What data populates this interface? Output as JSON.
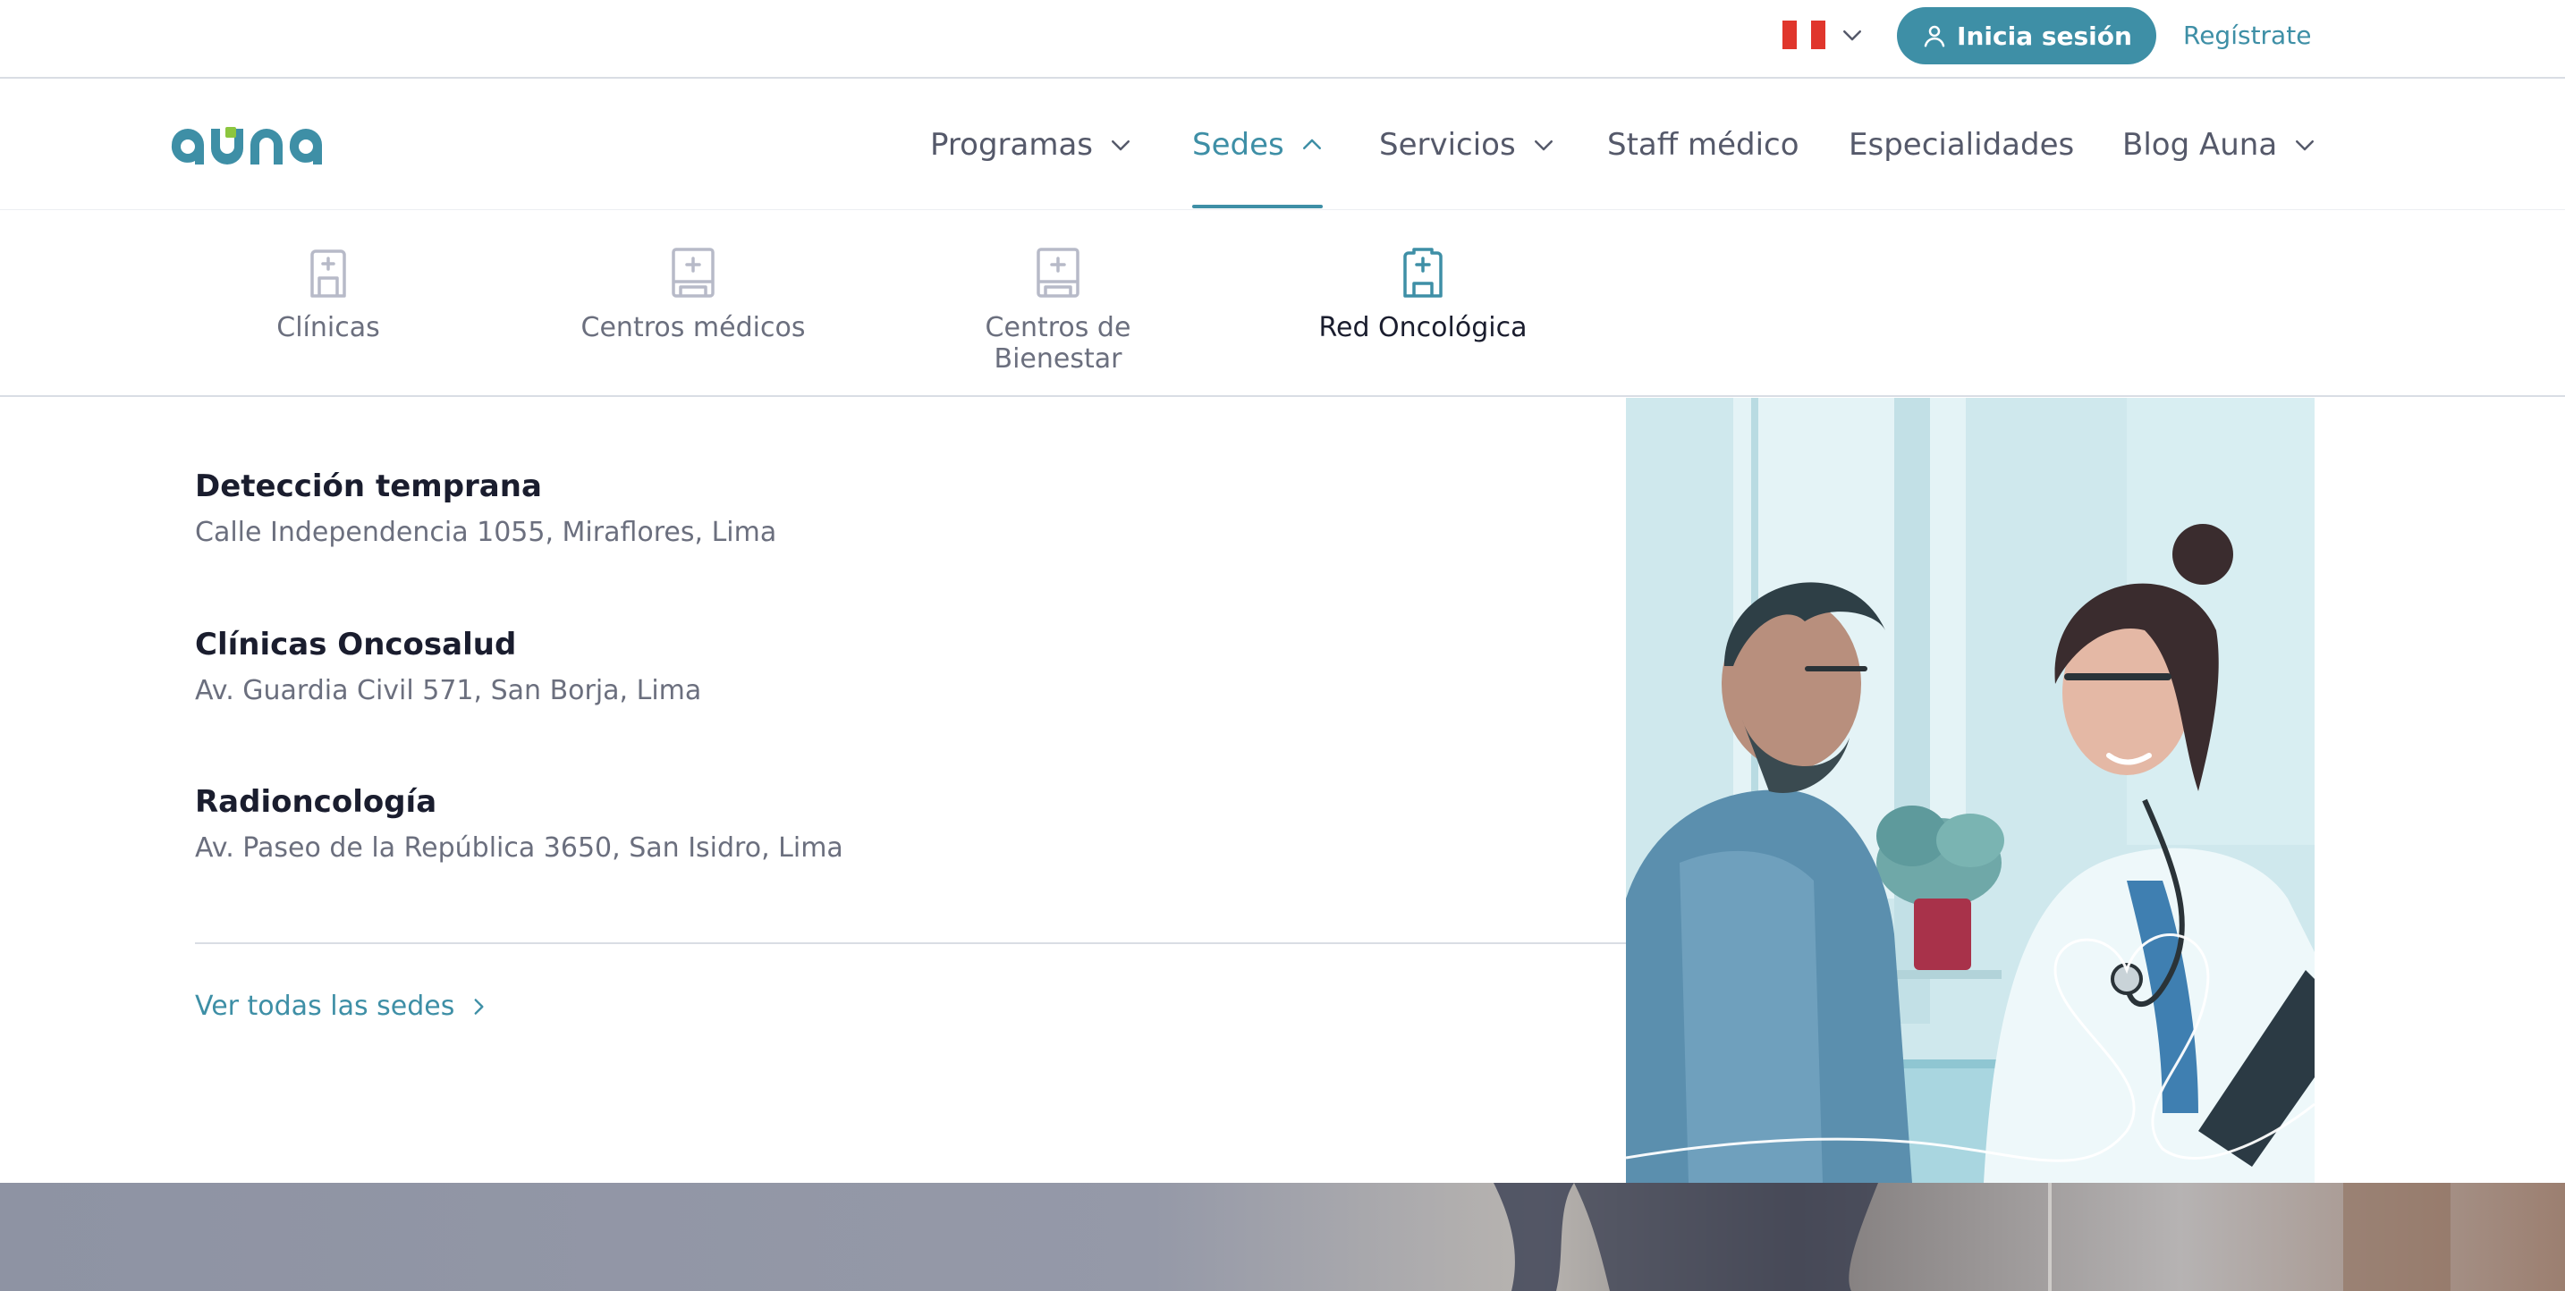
{
  "topbar": {
    "country_flag": "peru-flag",
    "login_label": "Inicia sesión",
    "register_label": "Regístrate"
  },
  "brand": {
    "logo_text": "auna",
    "accent_color": "#3e8fa6",
    "logo_green": "#8cc63f"
  },
  "nav": {
    "items": [
      {
        "label": "Programas",
        "has_dropdown": true,
        "active": false
      },
      {
        "label": "Sedes",
        "has_dropdown": true,
        "active": true
      },
      {
        "label": "Servicios",
        "has_dropdown": true,
        "active": false
      },
      {
        "label": "Staff médico",
        "has_dropdown": false,
        "active": false
      },
      {
        "label": "Especialidades",
        "has_dropdown": false,
        "active": false
      },
      {
        "label": "Blog Auna",
        "has_dropdown": true,
        "active": false
      }
    ]
  },
  "sedes_menu": {
    "categories": [
      {
        "label": "Clínicas",
        "icon": "hospital-icon",
        "active": false
      },
      {
        "label": "Centros médicos",
        "icon": "medical-center-icon",
        "active": false
      },
      {
        "label": "Centros de Bienestar",
        "icon": "wellness-center-icon",
        "active": false
      },
      {
        "label": "Red Oncológica",
        "icon": "oncology-network-icon",
        "active": true
      }
    ],
    "locations": [
      {
        "name": "Detección temprana",
        "address": "Calle Independencia 1055, Miraflores, Lima"
      },
      {
        "name": "Clínicas Oncosalud",
        "address": "Av. Guardia Civil 571, San Borja, Lima"
      },
      {
        "name": "Radioncología",
        "address": "Av. Paseo de la República 3650, San Isidro, Lima"
      }
    ],
    "see_all_label": "Ver todas las sedes"
  }
}
